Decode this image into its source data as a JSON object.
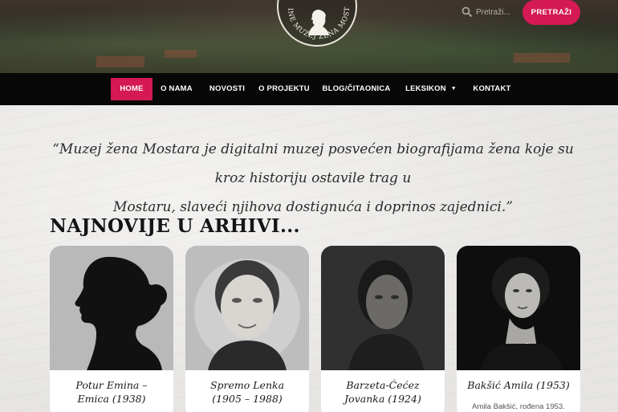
{
  "header": {
    "logo_text": "ONLINE MUZEJ ŽENA MOSTARA",
    "search_placeholder": "Pretraži...",
    "search_button": "PRETRAŽI"
  },
  "nav": {
    "items": [
      {
        "label": "HOME"
      },
      {
        "label": "O NAMA"
      },
      {
        "label": "NOVOSTI"
      },
      {
        "label": "O PROJEKTU"
      },
      {
        "label": "BLOG/ČITAONICA"
      },
      {
        "label": "LEKSIKON"
      },
      {
        "label": "KONTAKT"
      }
    ],
    "active": "HOME"
  },
  "main": {
    "quote_line1": "“Muzej žena Mostara je digitalni muzej posvećen biografijama žena koje su kroz historiju ostavile trag u",
    "quote_line2": "Mostaru, slaveći njihova dostignuća i doprinos zajednici.”",
    "section_title": "NAJNOVIJE U ARHIVI...",
    "cards": [
      {
        "name_line1": "Potur Emina –",
        "name_line2": "Emica (1938)",
        "excerpt": ""
      },
      {
        "name_line1": "Spremo Lenka",
        "name_line2": "(1905 – 1988)",
        "excerpt": ""
      },
      {
        "name_line1": "Barzeta-Ćećez",
        "name_line2": "Jovanka (1924)",
        "excerpt": ""
      },
      {
        "name_line1": "Bakšić Amila (1953)",
        "name_line2": "",
        "excerpt": "Amila Bakšić, rođena 1953."
      }
    ]
  },
  "colors": {
    "accent": "#d41955",
    "nav_bg": "#080808"
  },
  "icons": {
    "search": "search-icon",
    "dropdown": "chevron-down-icon"
  }
}
